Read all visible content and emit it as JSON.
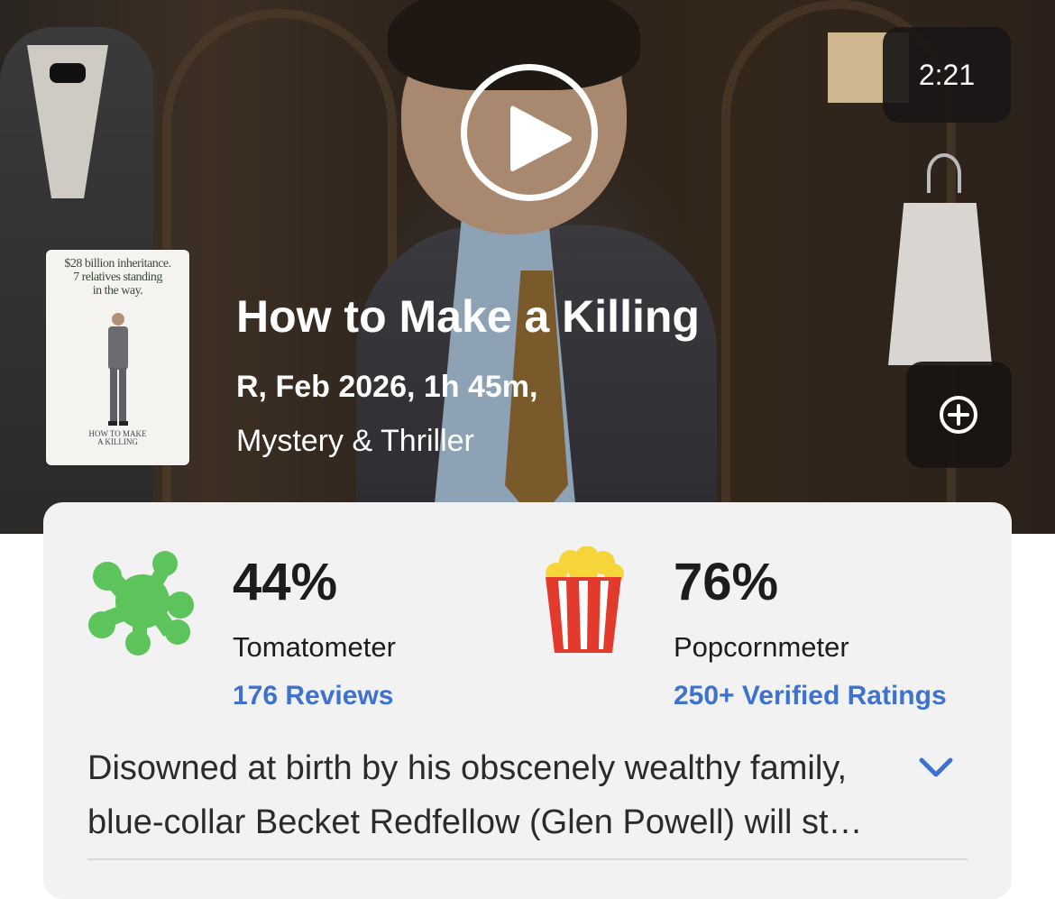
{
  "trailer": {
    "duration": "2:21"
  },
  "poster": {
    "tagline_line1": "$28 billion inheritance.",
    "tagline_line2": "7 relatives standing",
    "tagline_line3": "in the way.",
    "title_line1": "HOW TO MAKE",
    "title_line2": "A KILLING"
  },
  "movie": {
    "title": "How to Make a Killing",
    "meta": "R, Feb 2026, 1h 45m,",
    "genre": "Mystery & Thriller"
  },
  "scores": {
    "tomatometer": {
      "value": "44%",
      "label": "Tomatometer",
      "link": "176 Reviews",
      "icon": "splat-icon",
      "color": "#5cc45a"
    },
    "popcornmeter": {
      "value": "76%",
      "label": "Popcornmeter",
      "link": "250+ Verified Ratings",
      "icon": "popcorn-icon",
      "color": "#e23b2e"
    }
  },
  "synopsis": {
    "text": "Disowned at birth by his obscenely wealthy family, blue-collar Becket Redfellow (Glen Powell) will stop at nothing to reclaim his fortune — even if it means killing off every relative standing in his way."
  },
  "colors": {
    "link": "#3d72cf",
    "card_bg": "#f2f2f2"
  }
}
